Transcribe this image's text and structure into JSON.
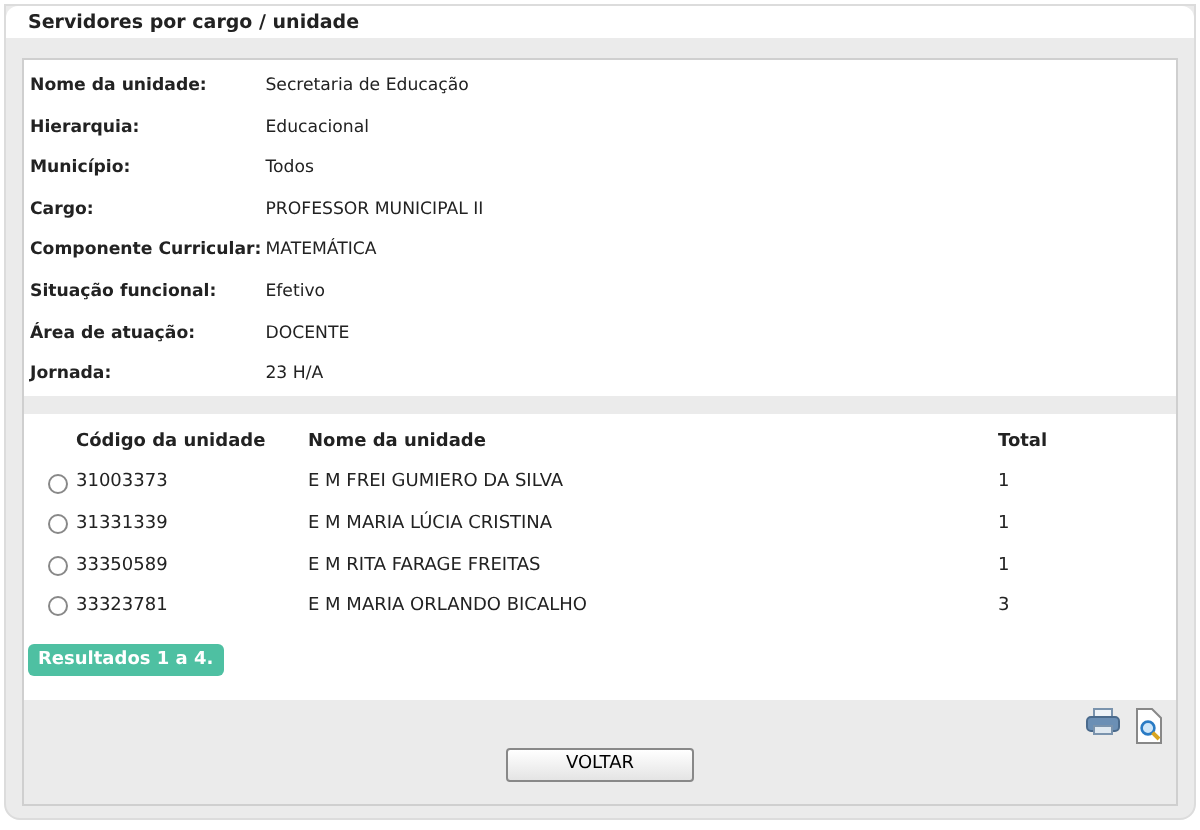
{
  "panel": {
    "title": "Servidores por cargo / unidade"
  },
  "details": [
    {
      "label": "Nome da unidade:",
      "value": "Secretaria de Educação"
    },
    {
      "label": "Hierarquia:",
      "value": "Educacional"
    },
    {
      "label": "Município:",
      "value": "Todos"
    },
    {
      "label": "Cargo:",
      "value": "PROFESSOR MUNICIPAL II"
    },
    {
      "label": "Componente Curricular:",
      "value": "MATEMÁTICA"
    },
    {
      "label": "Situação funcional:",
      "value": "Efetivo"
    },
    {
      "label": "Área de atuação:",
      "value": "DOCENTE"
    },
    {
      "label": "Jornada:",
      "value": "23 H/A"
    }
  ],
  "table": {
    "columns": [
      "Código da unidade",
      "Nome da unidade",
      "Total"
    ],
    "rows": [
      {
        "code": "31003373",
        "name": "E M FREI GUMIERO DA SILVA",
        "total": "1",
        "selected": false
      },
      {
        "code": "31331339",
        "name": "E M MARIA LÚCIA CRISTINA",
        "total": "1",
        "selected": false
      },
      {
        "code": "33350589",
        "name": "E M RITA FARAGE FREITAS",
        "total": "1",
        "selected": false
      },
      {
        "code": "33323781",
        "name": "E M MARIA ORLANDO BICALHO",
        "total": "3",
        "selected": false
      }
    ]
  },
  "results_badge": "Resultados 1 a 4.",
  "buttons": [
    "VOLTAR"
  ]
}
